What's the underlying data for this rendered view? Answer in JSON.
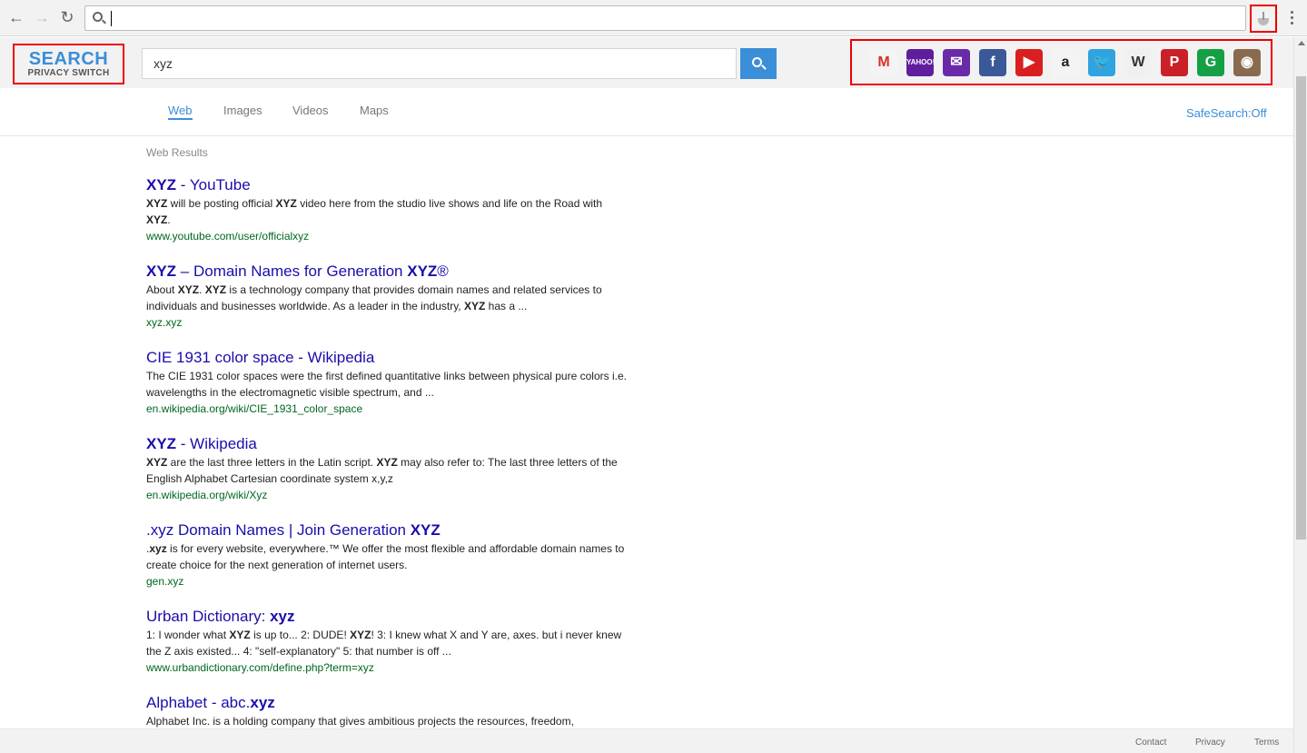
{
  "browser": {
    "back_icon": "arrow-left-icon",
    "forward_icon": "arrow-right-icon",
    "reload_icon": "reload-icon",
    "address_value": "",
    "extension_icon": "extension-icon",
    "menu_icon": "kebab-menu-icon"
  },
  "header": {
    "logo_main": "SEARCH",
    "logo_sub": "PRIVACY SWITCH",
    "search_value": "xyz",
    "search_button_icon": "search-icon",
    "accent_color": "#3b8ed8",
    "quick_links": [
      {
        "name": "gmail-icon",
        "glyph": "M",
        "bg": "#f4f4f4",
        "fg": "#d93025"
      },
      {
        "name": "yahoo-icon",
        "glyph": "YAHOO!",
        "bg": "#5f1f9c",
        "fg": "#ffffff"
      },
      {
        "name": "yahoo-mail-icon",
        "glyph": "✉",
        "bg": "#6a2aa8",
        "fg": "#ffffff"
      },
      {
        "name": "facebook-icon",
        "glyph": "f",
        "bg": "#3b5998",
        "fg": "#ffffff"
      },
      {
        "name": "youtube-icon",
        "glyph": "▶",
        "bg": "#d91f1f",
        "fg": "#ffffff"
      },
      {
        "name": "amazon-icon",
        "glyph": "a",
        "bg": "#f4f4f4",
        "fg": "#222222"
      },
      {
        "name": "twitter-icon",
        "glyph": "🐦",
        "bg": "#2ea4e0",
        "fg": "#ffffff"
      },
      {
        "name": "wikipedia-icon",
        "glyph": "W",
        "bg": "#f0f0f0",
        "fg": "#333333"
      },
      {
        "name": "pinterest-icon",
        "glyph": "P",
        "bg": "#cb2027",
        "fg": "#ffffff"
      },
      {
        "name": "grammarly-icon",
        "glyph": "G",
        "bg": "#15a045",
        "fg": "#ffffff"
      },
      {
        "name": "instagram-icon",
        "glyph": "◉",
        "bg": "#8a6a4f",
        "fg": "#ffffff"
      }
    ]
  },
  "tabs": [
    {
      "label": "Web",
      "active": true
    },
    {
      "label": "Images",
      "active": false
    },
    {
      "label": "Videos",
      "active": false
    },
    {
      "label": "Maps",
      "active": false
    }
  ],
  "safesearch": "SafeSearch:Off",
  "results_label": "Web Results",
  "results": [
    {
      "title_html": "<b>XYZ</b> - YouTube",
      "desc_html": "<b>XYZ</b> will be posting official <b>XYZ</b> video here from the studio live shows and life on the Road with <b>XYZ</b>.",
      "url": "www.youtube.com/user/officialxyz"
    },
    {
      "title_html": "<b>XYZ</b> – Domain Names for Generation <b>XYZ</b>®",
      "desc_html": "About <b>XYZ</b>. <b>XYZ</b> is a technology company that provides domain names and related services to individuals and businesses worldwide. As a leader in the industry, <b>XYZ</b> has a ...",
      "url": "xyz.xyz"
    },
    {
      "title_html": "CIE 1931 color space - Wikipedia",
      "desc_html": "The CIE 1931 color spaces were the first defined quantitative links between physical pure colors i.e. wavelengths in the electromagnetic visible spectrum, and ...",
      "url": "en.wikipedia.org/wiki/CIE_1931_color_space"
    },
    {
      "title_html": "<b>XYZ</b> - Wikipedia",
      "desc_html": "<b>XYZ</b> are the last three letters in the Latin script. <b>XYZ</b> may also refer to: The last three letters of the English Alphabet Cartesian coordinate system x,y,z",
      "url": "en.wikipedia.org/wiki/Xyz"
    },
    {
      "title_html": ".xyz Domain Names | Join Generation <b>XYZ</b>",
      "desc_html": ".<b>xyz</b> is for every website, everywhere.™ We offer the most flexible and affordable domain names to create choice for the next generation of internet users.",
      "url": "gen.xyz"
    },
    {
      "title_html": "Urban Dictionary: <b>xyz</b>",
      "desc_html": "1: I wonder what <b>XYZ</b> is up to... 2: DUDE! <b>XYZ</b>! 3: I knew what X and Y are, axes. but i never knew the Z axis existed... 4: \"self-explanatory\" 5: that number is off ...",
      "url": "www.urbandictionary.com/define.php?term=xyz"
    },
    {
      "title_html": "Alphabet - abc.<b>xyz</b>",
      "desc_html": "Alphabet Inc. is a holding company that gives ambitious projects the resources, freedom,",
      "url": ""
    }
  ],
  "footer": {
    "contact": "Contact",
    "privacy": "Privacy",
    "terms": "Terms"
  }
}
